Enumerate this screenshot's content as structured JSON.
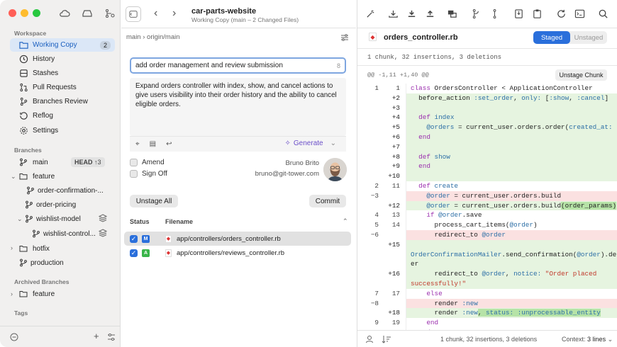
{
  "sidebar": {
    "workspace_heading": "Workspace",
    "items": [
      {
        "label": "Working Copy",
        "count": "2"
      },
      {
        "label": "History"
      },
      {
        "label": "Stashes"
      },
      {
        "label": "Pull Requests"
      },
      {
        "label": "Branches Review"
      },
      {
        "label": "Reflog"
      },
      {
        "label": "Settings"
      }
    ],
    "branches_heading": "Branches",
    "branches": {
      "main": "main",
      "head_badge": "HEAD",
      "head_ahead": "↑3",
      "feature": "feature",
      "order_confirmation": "order-confirmation-...",
      "order_pricing": "order-pricing",
      "wishlist_model": "wishlist-model",
      "wishlist_control": "wishlist-control...",
      "hotfix": "hotfix",
      "production": "production"
    },
    "archived_heading": "Archived Branches",
    "archived_feature": "feature",
    "tags_heading": "Tags"
  },
  "header": {
    "repo": "car-parts-website",
    "subtitle": "Working Copy (main – 2 Changed Files)"
  },
  "commit": {
    "breadcrumb": "main › origin/main",
    "subject": "add order management and review submission",
    "subject_count": "8",
    "body": "Expand orders controller with index, show, and cancel actions to give users visibility into their order history and the ability to cancel eligible orders.",
    "generate_label": "Generate",
    "amend_label": "Amend",
    "signoff_label": "Sign Off",
    "author_name": "Bruno Brito",
    "author_email": "bruno@git-tower.com",
    "unstage_all_label": "Unstage All",
    "commit_label": "Commit"
  },
  "files": {
    "status_header": "Status",
    "filename_header": "Filename",
    "rows": [
      {
        "status": "M",
        "status_color": "#2a6fdb",
        "path": "app/controllers/orders_controller.rb"
      },
      {
        "status": "A",
        "status_color": "#3ab54a",
        "path": "app/controllers/reviews_controller.rb"
      }
    ]
  },
  "diff": {
    "filename": "orders_controller.rb",
    "staged_label": "Staged",
    "unstaged_label": "Unstaged",
    "summary": "1 chunk, 32 insertions, 3 deletions",
    "hunk_header": "@@ -1,11 +1,40 @@",
    "unstage_chunk_label": "Unstage Chunk",
    "footer_summary": "1 chunk, 32 insertions, 3 deletions",
    "context_label": "Context:",
    "context_value": "3 lines"
  }
}
